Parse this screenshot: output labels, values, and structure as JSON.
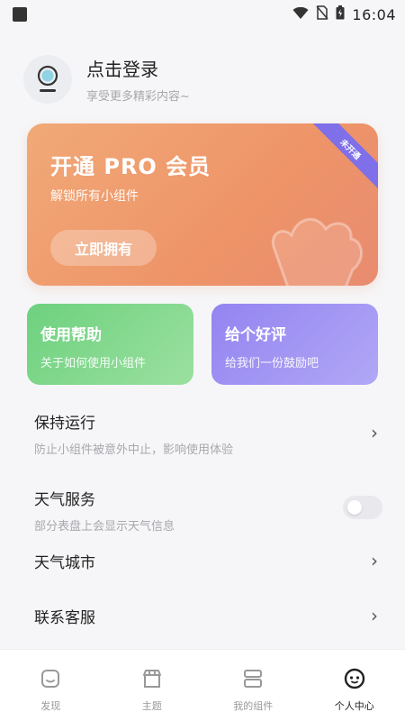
{
  "status": {
    "time": "16:04"
  },
  "profile": {
    "title": "点击登录",
    "subtitle": "享受更多精彩内容~"
  },
  "pro": {
    "title": "开通 PRO 会员",
    "subtitle": "解锁所有小组件",
    "button": "立即拥有",
    "ribbon": "未开通"
  },
  "quick": {
    "help": {
      "title": "使用帮助",
      "subtitle": "关于如何使用小组件"
    },
    "rate": {
      "title": "给个好评",
      "subtitle": "给我们一份鼓励吧"
    }
  },
  "list": {
    "keep_running": {
      "title": "保持运行",
      "subtitle": "防止小组件被意外中止，影响使用体验"
    },
    "weather_service": {
      "title": "天气服务",
      "subtitle": "部分表盘上会显示天气信息"
    },
    "weather_city": {
      "title": "天气城市"
    },
    "contact": {
      "title": "联系客服"
    }
  },
  "nav": [
    {
      "label": "发现",
      "icon": "discover-icon"
    },
    {
      "label": "主题",
      "icon": "store-icon"
    },
    {
      "label": "我的组件",
      "icon": "widgets-icon"
    },
    {
      "label": "个人中心",
      "icon": "profile-icon"
    }
  ],
  "colors": {
    "pro_start": "#f1a978",
    "pro_end": "#e88b70",
    "help": "#6dd17e",
    "rate": "#9384f0",
    "ribbon": "#7f6fe8"
  }
}
